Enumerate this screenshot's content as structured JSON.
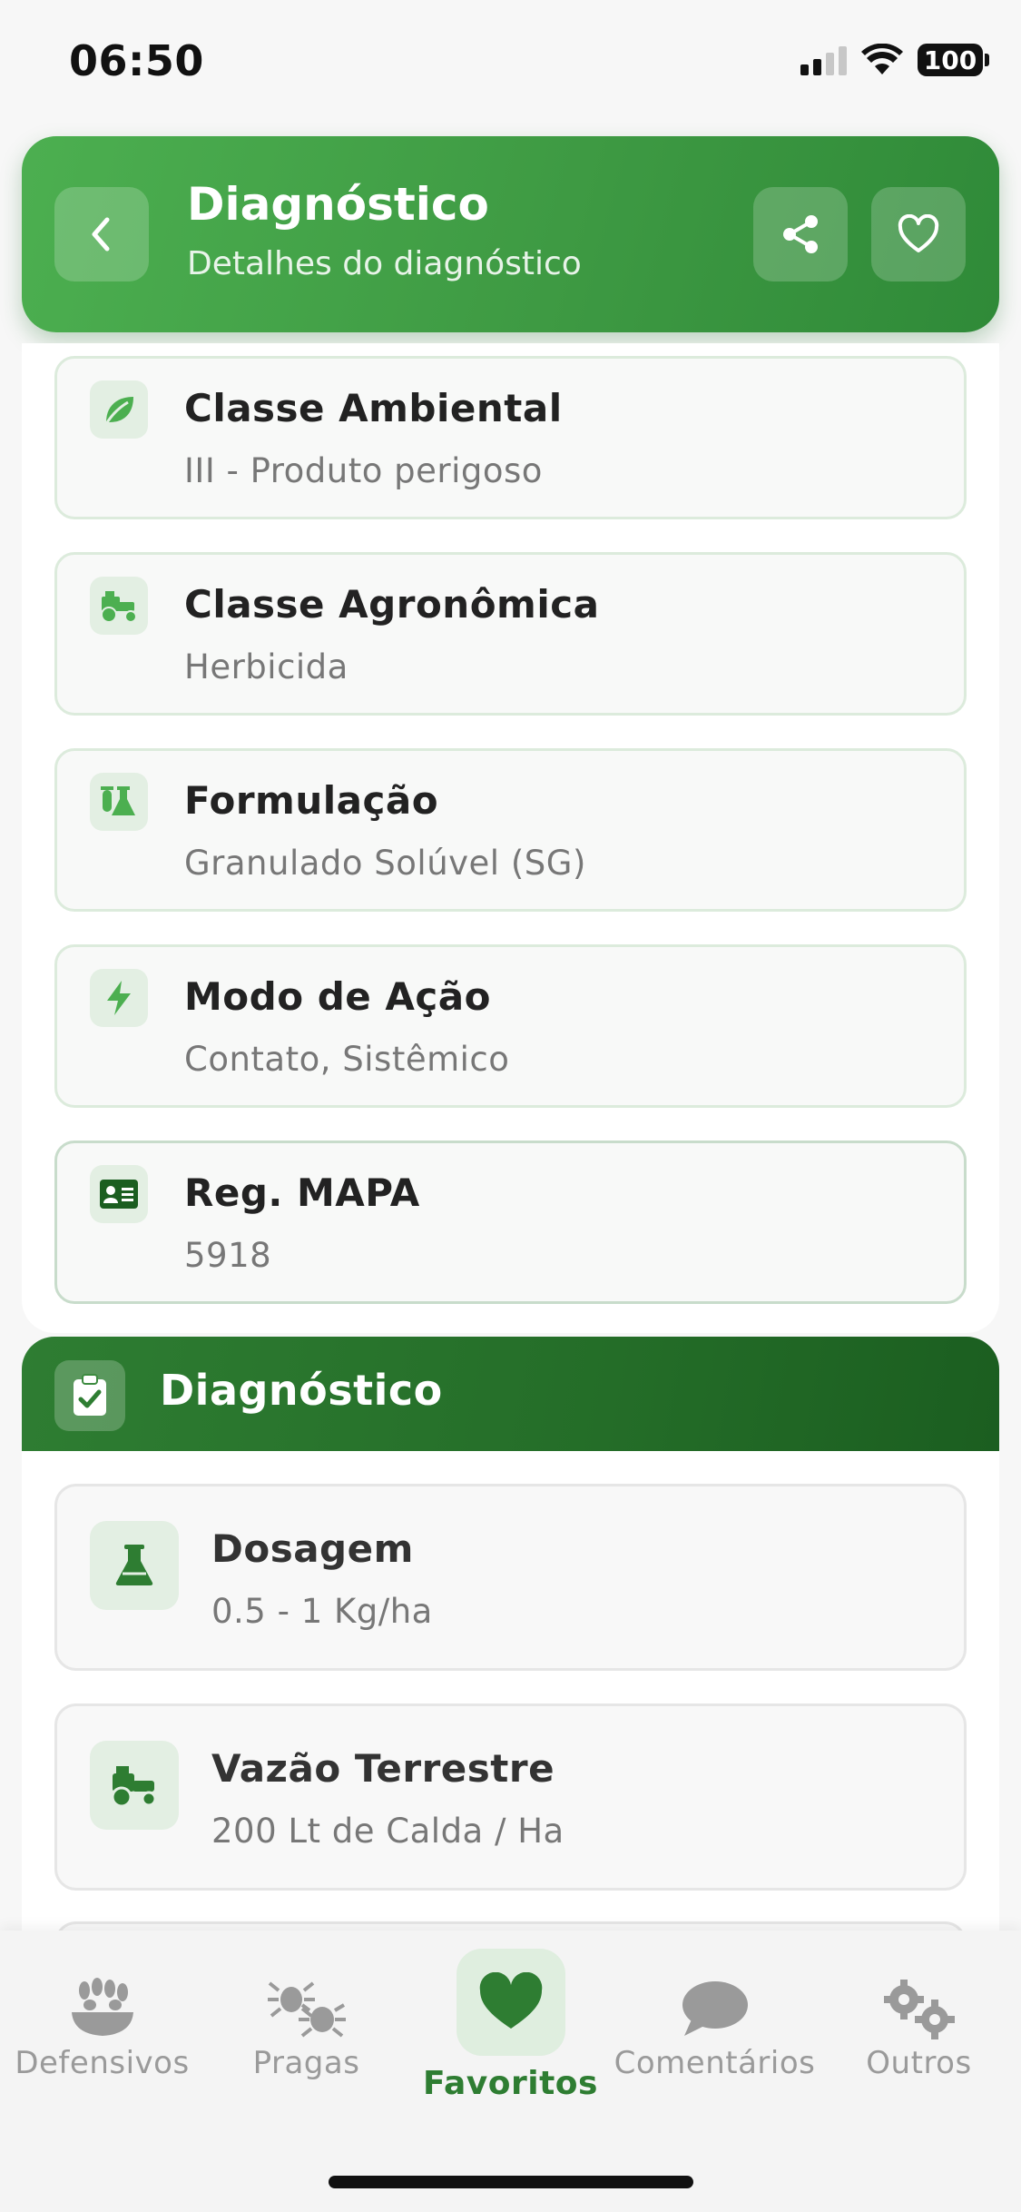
{
  "status_bar": {
    "time": "06:50",
    "battery": "100"
  },
  "header": {
    "title": "Diagnóstico",
    "subtitle": "Detalhes do diagnóstico",
    "back_icon": "chevron-left-icon",
    "share_icon": "share-icon",
    "favorite_icon": "heart-outline-icon"
  },
  "info_items": [
    {
      "label": "Classe Ambiental",
      "value": "III - Produto perigoso",
      "icon": "leaf-icon"
    },
    {
      "label": "Classe Agronômica",
      "value": "Herbicida",
      "icon": "tractor-icon"
    },
    {
      "label": "Formulação",
      "value": "Granulado Solúvel (SG)",
      "icon": "flask-vials-icon"
    },
    {
      "label": "Modo de Ação",
      "value": "Contato, Sistêmico",
      "icon": "bolt-icon"
    },
    {
      "label": "Reg. MAPA",
      "value": "5918",
      "icon": "id-card-icon"
    }
  ],
  "diagnostico": {
    "title": "Diagnóstico",
    "icon": "clipboard-check-icon",
    "items": [
      {
        "label": "Dosagem",
        "value": "0.5 - 1 Kg/ha",
        "icon": "flask-icon"
      },
      {
        "label": "Vazão Terrestre",
        "value": "200 Lt de Calda / Ha",
        "icon": "tractor-icon"
      }
    ]
  },
  "bottom_nav": [
    {
      "label": "Defensivos",
      "icon": "seeds-bowl-icon",
      "active": false
    },
    {
      "label": "Pragas",
      "icon": "bug-icon",
      "active": false
    },
    {
      "label": "Favoritos",
      "icon": "heart-icon",
      "active": true
    },
    {
      "label": "Comentários",
      "icon": "comment-icon",
      "active": false
    },
    {
      "label": "Outros",
      "icon": "gears-icon",
      "active": false
    }
  ],
  "colors": {
    "primary": "#4caf50",
    "primary_dark": "#2e7d32",
    "muted_text": "#777777",
    "nav_inactive": "#9a9a9a"
  }
}
